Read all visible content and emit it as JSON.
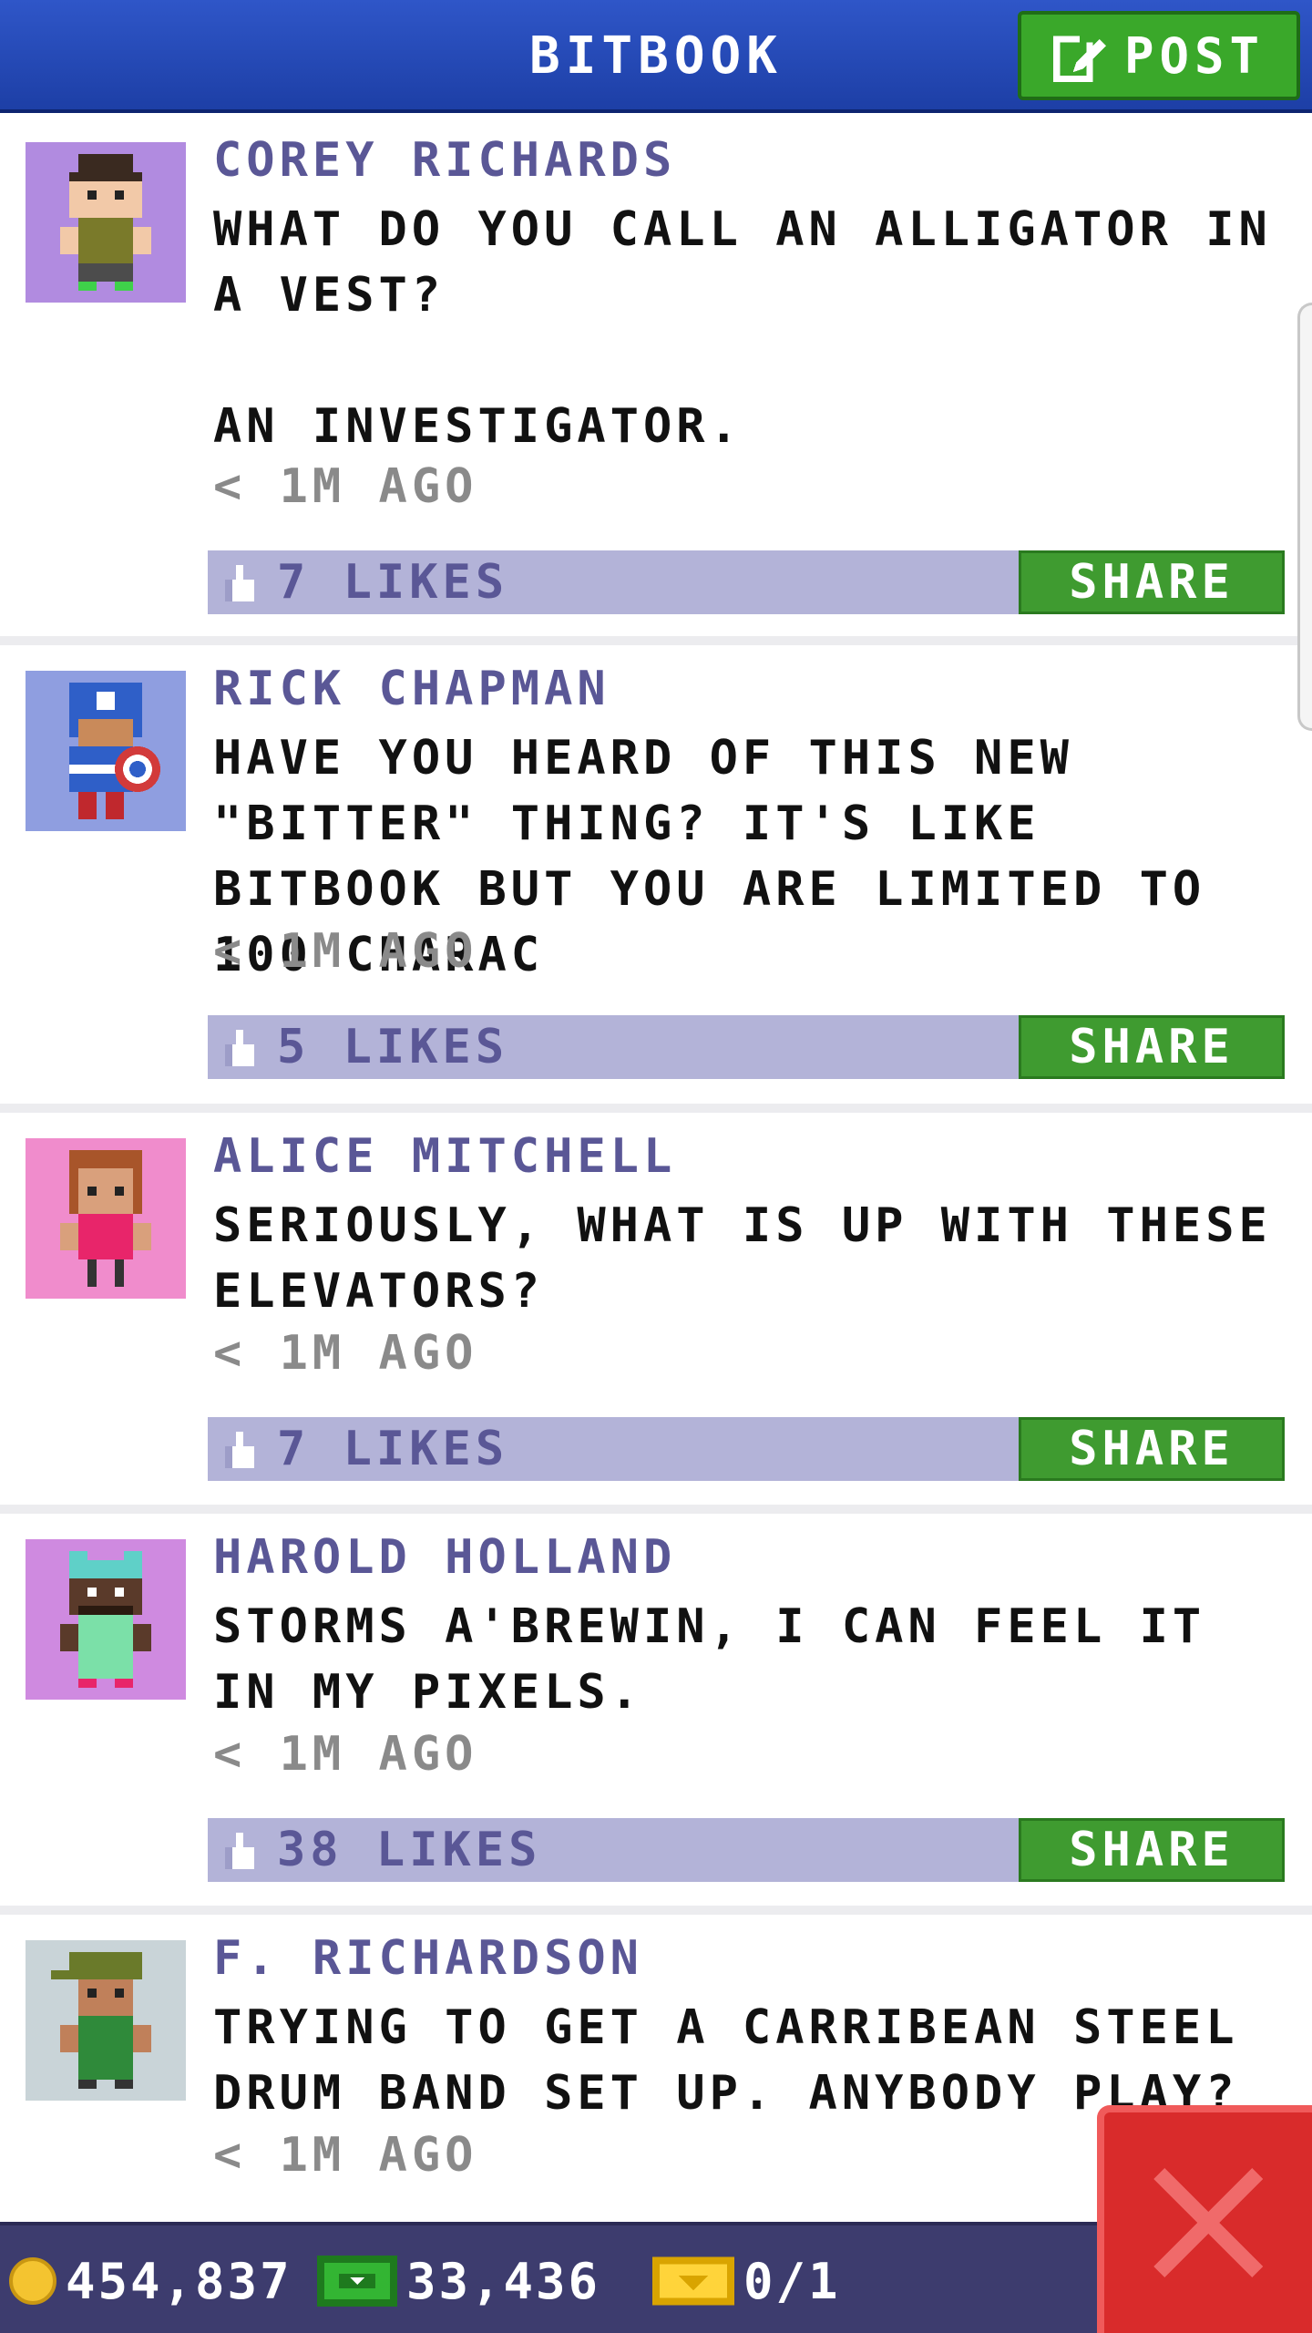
{
  "header": {
    "title": "BITBOOK",
    "post_label": "POST",
    "colors": {
      "bar": "#1f44b3",
      "post_button": "#3aa82a"
    }
  },
  "feed": {
    "posts": [
      {
        "author": "COREY RICHARDS",
        "message": "WHAT DO YOU CALL AN ALLIGATOR IN A VEST?\n\nAN INVESTIGATOR.",
        "timestamp": "< 1M AGO",
        "likes": "7 LIKES",
        "share": "SHARE",
        "avatar_icon": "pixel-man-olive-shirt-icon",
        "avatar_bg": "#b18be0"
      },
      {
        "author": "RICK CHAPMAN",
        "message": "HAVE YOU HEARD OF THIS NEW \"BITTER\" THING? IT'S LIKE BITBOOK BUT YOU ARE LIMITED TO 100 CHARAC",
        "timestamp": "< 1M AGO",
        "likes": "5 LIKES",
        "share": "SHARE",
        "avatar_icon": "pixel-superhero-shield-icon",
        "avatar_bg": "#8f9ee0"
      },
      {
        "author": "ALICE MITCHELL",
        "message": "SERIOUSLY, WHAT IS UP WITH THESE ELEVATORS?",
        "timestamp": "< 1M AGO",
        "likes": "7 LIKES",
        "share": "SHARE",
        "avatar_icon": "pixel-woman-pink-dress-icon",
        "avatar_bg": "#f08ccc"
      },
      {
        "author": "HAROLD HOLLAND",
        "message": "STORMS A'BREWIN, I CAN FEEL IT IN MY PIXELS.",
        "timestamp": "< 1M AGO",
        "likes": "38 LIKES",
        "share": "SHARE",
        "avatar_icon": "pixel-man-cat-hat-icon",
        "avatar_bg": "#cf8ae0"
      },
      {
        "author": "F. RICHARDSON",
        "message": "TRYING TO GET A CARRIBEAN STEEL DRUM BAND SET UP. ANYBODY PLAY?",
        "timestamp": "< 1M AGO",
        "avatar_icon": "pixel-man-green-cap-icon",
        "avatar_bg": "#c9d4d8"
      }
    ]
  },
  "footer": {
    "coins": "454,837",
    "bux": "33,436",
    "tickets": "0/1",
    "icons": [
      "coin-icon",
      "bux-icon",
      "ticket-icon",
      "close-icon"
    ]
  }
}
